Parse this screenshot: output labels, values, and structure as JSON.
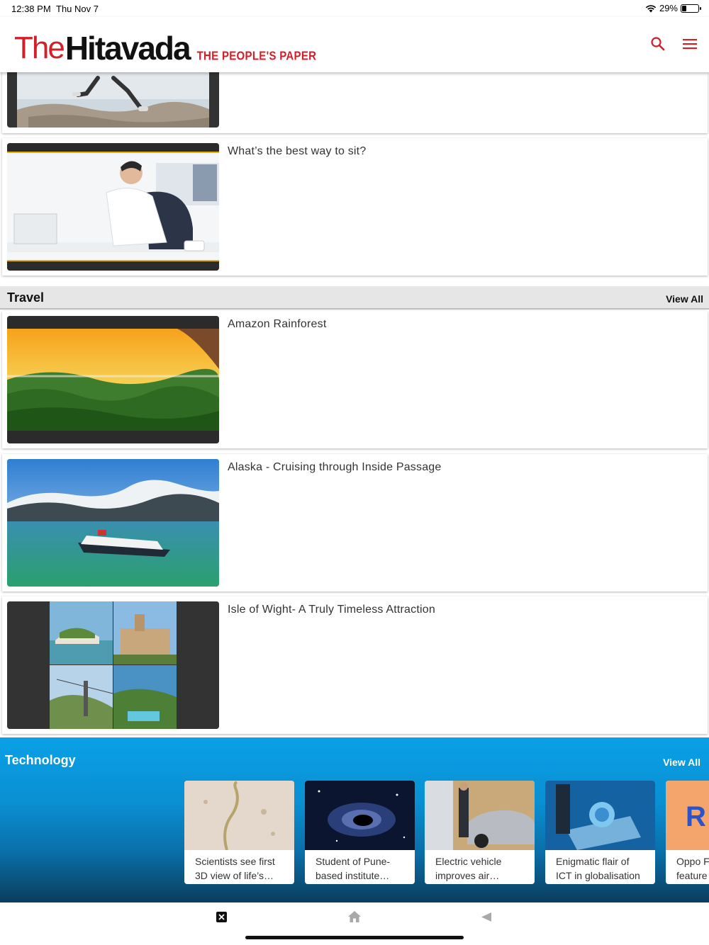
{
  "status_bar": {
    "time": "12:38 PM",
    "date": "Thu Nov 7",
    "battery": "29%",
    "battery_level": 0.29
  },
  "header": {
    "logo_the": "The",
    "logo_name": "Hitavada",
    "logo_tagline": "THE PEOPLE'S PAPER",
    "search_icon": "search-icon",
    "menu_icon": "menu-icon",
    "accent_color": "#d0202a"
  },
  "health": {
    "articles": [
      {
        "title": ""
      },
      {
        "title": "What’s the best way to sit?"
      }
    ]
  },
  "travel": {
    "title": "Travel",
    "view_all": "View All",
    "articles": [
      {
        "title": "Amazon Rainforest"
      },
      {
        "title": "Alaska - Cruising through Inside Passage"
      },
      {
        "title": "Isle of Wight- A Truly Timeless Attraction"
      }
    ]
  },
  "technology": {
    "title": "Technology",
    "view_all": "View All",
    "articles": [
      {
        "caption": "Scientists see first\n3D view of life’s…"
      },
      {
        "caption": "Student of Pune-\nbased institute…"
      },
      {
        "caption": "Electric vehicle\nimproves air…"
      },
      {
        "caption": "Enigmatic flair of\nICT in globalisation"
      },
      {
        "caption": "Oppo F\nfeature"
      }
    ]
  },
  "bottom_nav": {
    "close_icon": "close-icon",
    "home_icon": "home-icon",
    "back_icon": "back-icon"
  }
}
